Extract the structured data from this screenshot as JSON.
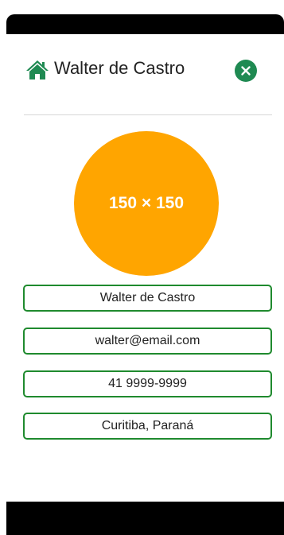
{
  "header": {
    "title": "Walter de Castro",
    "home_icon": "home-icon",
    "close_icon": "close-icon"
  },
  "avatar": {
    "placeholder_text": "150 × 150"
  },
  "profile": {
    "name": "Walter de Castro",
    "email": "walter@email.com",
    "phone": "41 9999-9999",
    "location": "Curitiba, Paraná"
  },
  "colors": {
    "accent": "#1f8a52",
    "field_border": "#1f8a2e",
    "avatar_bg": "#ffa500"
  }
}
